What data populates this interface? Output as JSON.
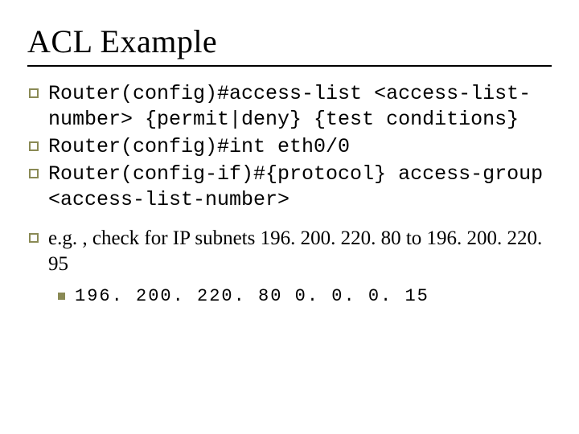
{
  "title": "ACL Example",
  "bullets": [
    "Router(config)#access-list <access-list-number> {permit|deny} {test conditions}",
    "Router(config)#int eth0/0",
    "Router(config-if)#{protocol} access-group <access-list-number>"
  ],
  "example_intro": "e.g. , check for IP subnets 196. 200. 220. 80 to 196. 200. 220. 95",
  "example_sub": "196. 200. 220. 80 0. 0. 0. 15"
}
